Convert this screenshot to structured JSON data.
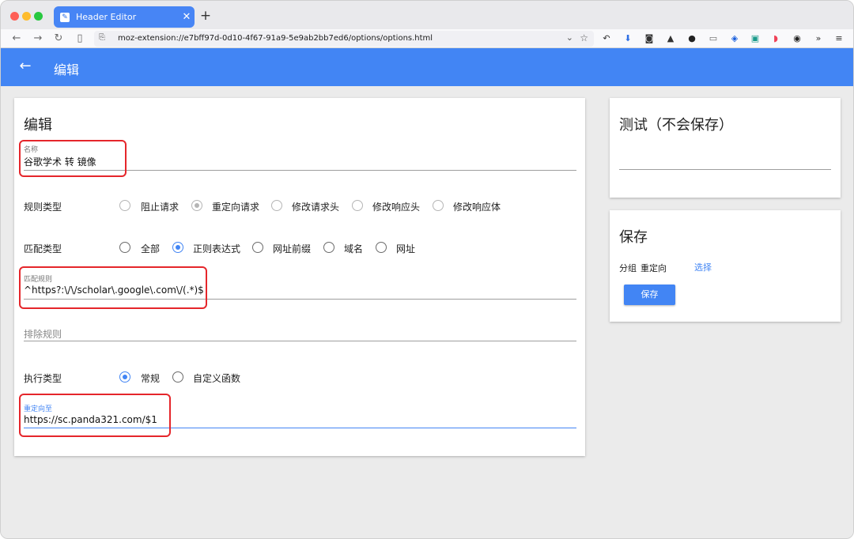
{
  "browser": {
    "tab_title": "Header Editor",
    "new_tab_symbol": "+",
    "close_symbol": "✕",
    "url": "moz-extension://e7bff97d-0d10-4f67-91a9-5e9ab2bb7ed6/options/options.html",
    "toolbar_icons": [
      "undo-icon",
      "download-icon",
      "camera-icon",
      "rocket-icon",
      "circle-icon",
      "reader-icon",
      "bitwarden-icon",
      "save-icon",
      "pocket-icon",
      "panda-icon",
      "overflow-icon",
      "menu-icon"
    ],
    "accent_color": "#4785f5"
  },
  "appbar": {
    "title": "编辑",
    "color": "#4285f4"
  },
  "edit_card": {
    "title": "编辑",
    "name_field": {
      "label": "名称",
      "value": "谷歌学术 转 镜像"
    },
    "rule_type": {
      "label": "规则类型",
      "options": [
        "阻止请求",
        "重定向请求",
        "修改请求头",
        "修改响应头",
        "修改响应体"
      ],
      "selected": "重定向请求"
    },
    "match_type": {
      "label": "匹配类型",
      "options": [
        "全部",
        "正则表达式",
        "网址前缀",
        "域名",
        "网址"
      ],
      "selected": "正则表达式"
    },
    "match_rule": {
      "label": "匹配规则",
      "value": "^https?:\\/\\/scholar\\.google\\.com\\/(.*)$"
    },
    "exclude_rule": {
      "placeholder": "排除规则",
      "value": ""
    },
    "exec_type": {
      "label": "执行类型",
      "options": [
        "常规",
        "自定义函数"
      ],
      "selected": "常规"
    },
    "redirect_to": {
      "label": "重定向至",
      "value": "https://sc.panda321.com/$1"
    }
  },
  "test_card": {
    "title": "测试（不会保存）"
  },
  "save_card": {
    "title": "保存",
    "group_label": "分组",
    "group_value": "重定向",
    "choose_link": "选择",
    "save_button": "保存"
  },
  "annotation_color": "#e5262b"
}
